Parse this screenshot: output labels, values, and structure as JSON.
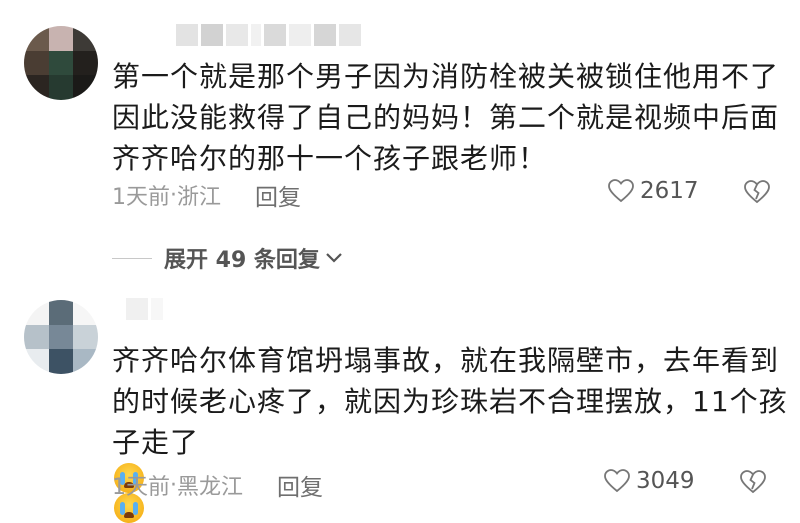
{
  "comments": [
    {
      "text_lines": [
        "第一个就是那个男子因为消防栓被关被锁住他用不了",
        "因此没能救得了自己的妈妈！第二个就是视频中后面",
        "齐齐哈尔的那十一个孩子跟老师！"
      ],
      "time": "1天前",
      "location": "浙江",
      "reply_label": "回复",
      "likes": "2617",
      "expand_label": "展开 49 条回复"
    },
    {
      "text_lines": [
        "齐齐哈尔体育馆坍塌事故，就在我隔壁市，去年看到",
        "的时候老心疼了，就因为珍珠岩不合理摆放，11个孩",
        "子走了"
      ],
      "emoji": [
        "loudly-crying-face-emoji",
        "loudly-crying-face-emoji"
      ],
      "time": "1天前",
      "location": "黑龙江",
      "reply_label": "回复",
      "likes": "3049"
    }
  ],
  "separator": "·",
  "icons": {
    "like": "heart-outline-icon",
    "dislike": "broken-heart-outline-icon",
    "expand": "chevron-down-icon"
  },
  "colors": {
    "text": "#1b1b1b",
    "meta": "#9a9a9a",
    "reply": "#6f6f6f"
  }
}
